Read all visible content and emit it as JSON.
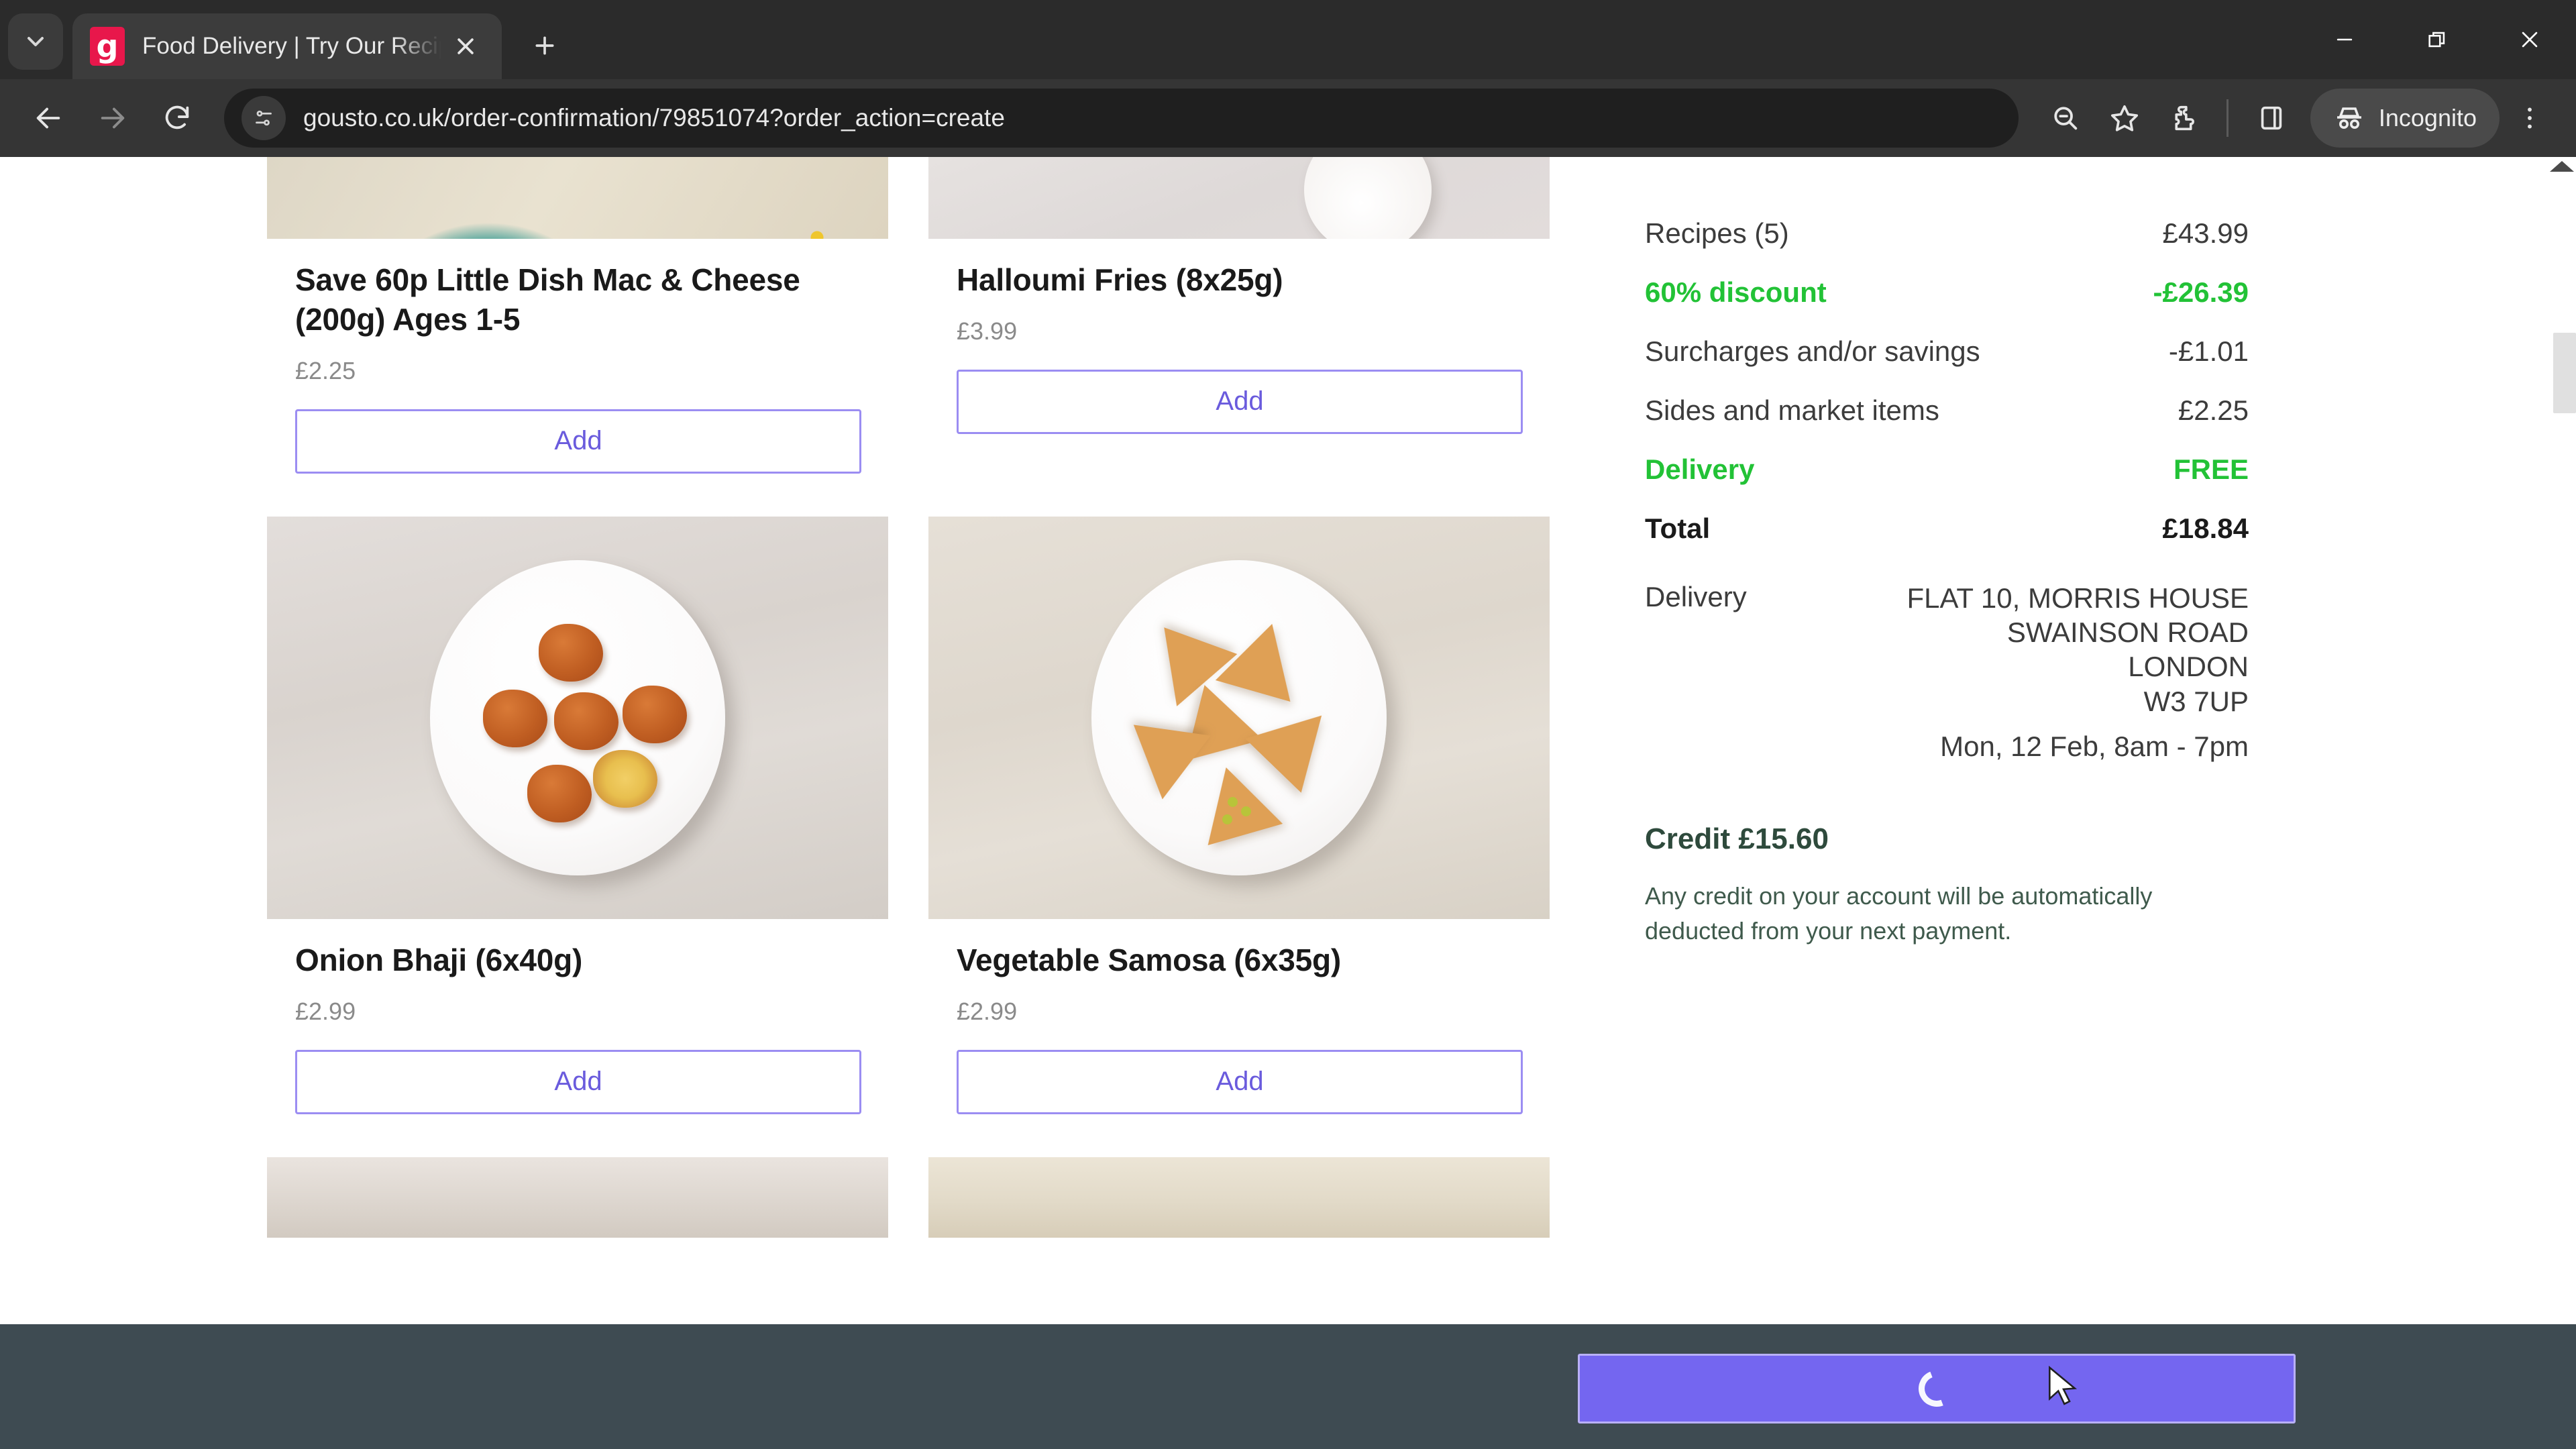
{
  "browser": {
    "tab": {
      "title": "Food Delivery | Try Our Recipe k",
      "favicon_letter": "g",
      "favicon_color": "#e8174b",
      "close_icon": "close-icon"
    },
    "tab_list_icon": "chevron-down-icon",
    "new_tab_icon": "plus-icon",
    "window_controls": {
      "minimize": "minimize-icon",
      "maximize": "restore-icon",
      "close": "close-icon"
    },
    "toolbar": {
      "back_icon": "arrow-left-icon",
      "forward_icon": "arrow-right-icon",
      "reload_icon": "reload-icon",
      "page_info_icon": "page-settings-icon",
      "url": "gousto.co.uk/order-confirmation/79851074?order_action=create",
      "zoom_icon": "zoom-out-icon",
      "bookmark_icon": "star-icon",
      "extensions_icon": "puzzle-piece-icon",
      "side_panel_icon": "side-panel-icon",
      "incognito_label": "Incognito",
      "incognito_icon": "incognito-icon",
      "menu_icon": "kebab-menu-icon"
    }
  },
  "products": [
    {
      "name": "Save 60p Little Dish Mac & Cheese (200g) Ages 1-5",
      "price": "£2.25",
      "add_label": "Add",
      "image": "mac-and-cheese-photo"
    },
    {
      "name": "Halloumi Fries (8x25g)",
      "price": "£3.99",
      "add_label": "Add",
      "image": "halloumi-fries-photo"
    },
    {
      "name": "Onion Bhaji (6x40g)",
      "price": "£2.99",
      "add_label": "Add",
      "image": "onion-bhaji-photo"
    },
    {
      "name": "Vegetable Samosa (6x35g)",
      "price": "£2.99",
      "add_label": "Add",
      "image": "vegetable-samosa-photo"
    }
  ],
  "summary": {
    "rows": [
      {
        "label": "Recipes (5)",
        "value": "£43.99",
        "style": "normal"
      },
      {
        "label": "60% discount",
        "value": "-£26.39",
        "style": "green"
      },
      {
        "label": "Surcharges and/or savings",
        "value": "-£1.01",
        "style": "normal"
      },
      {
        "label": "Sides and market items",
        "value": "£2.25",
        "style": "normal"
      },
      {
        "label": "Delivery",
        "value": "FREE",
        "style": "green"
      },
      {
        "label": "Total",
        "value": "£18.84",
        "style": "total"
      }
    ],
    "delivery": {
      "label": "Delivery",
      "address_line1": "FLAT 10, MORRIS HOUSE",
      "address_line2": "SWAINSON ROAD",
      "address_line3": "LONDON",
      "address_line4": "W3 7UP",
      "slot": "Mon, 12 Feb, 8am - 7pm"
    },
    "credit": {
      "title": "Credit £15.60",
      "note": "Any credit on your account will be automatically deducted from your next payment."
    }
  },
  "sticky_bar": {
    "cta_label": "",
    "cta_state": "loading",
    "spinner_icon": "loading-spinner-icon",
    "cta_color": "#7466f0"
  },
  "scrollbar": {
    "up_arrow_icon": "scroll-up-arrow-icon"
  },
  "colors": {
    "accent_purple": "#7466f0",
    "add_border": "#9b8df2",
    "green": "#22c236",
    "bar_dark": "#3e4b52"
  }
}
